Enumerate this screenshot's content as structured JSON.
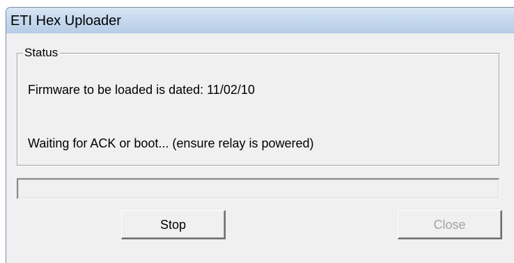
{
  "window": {
    "title": "ETI Hex Uploader"
  },
  "status_group": {
    "legend": "Status",
    "firmware_line": "Firmware to be loaded is dated:  11/02/10",
    "waiting_line": "Waiting for ACK or boot... (ensure relay is powered)"
  },
  "progress": {
    "fraction": 0
  },
  "buttons": {
    "stop_label": "Stop",
    "close_label": "Close",
    "close_enabled": false
  },
  "colors": {
    "titlebar": "#c6d9ee",
    "dialog_background": "#f0f0f0",
    "disabled_text": "#a3a3a3"
  }
}
